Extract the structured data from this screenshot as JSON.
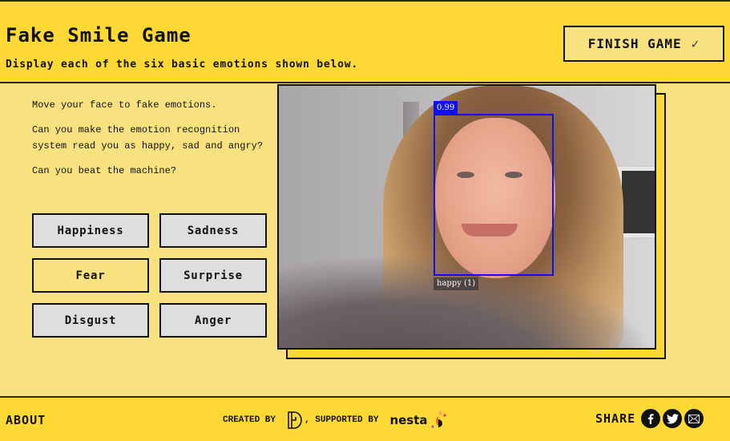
{
  "header": {
    "title": "Fake Smile Game",
    "subtitle": "Display each of the six basic emotions shown below.",
    "finish_button": {
      "label": "FINISH GAME",
      "icon": "check-icon",
      "glyph": "✓"
    }
  },
  "instructions": [
    "Move your face to fake emotions.",
    "Can you make the emotion recognition system read you as happy, sad and angry?",
    "Can you beat the machine?"
  ],
  "emotions": [
    {
      "label": "Happiness",
      "active": false
    },
    {
      "label": "Sadness",
      "active": false
    },
    {
      "label": "Fear",
      "active": true
    },
    {
      "label": "Surprise",
      "active": false
    },
    {
      "label": "Disgust",
      "active": false
    },
    {
      "label": "Anger",
      "active": false
    }
  ],
  "webcam": {
    "detection": {
      "score": "0.99",
      "label": "happy (1)",
      "box_color": "#1010ee"
    }
  },
  "footer": {
    "about": "ABOUT",
    "created_by": "CREATED BY",
    "supported_by": ", SUPPORTED BY",
    "supporter_logo_text": "nesta",
    "share_label": "SHARE",
    "social": [
      "facebook-icon",
      "twitter-icon",
      "email-icon"
    ]
  },
  "colors": {
    "header_bg": "#fed935",
    "main_bg": "#f8e27f",
    "button_bg": "#dedede",
    "border": "#111111"
  }
}
